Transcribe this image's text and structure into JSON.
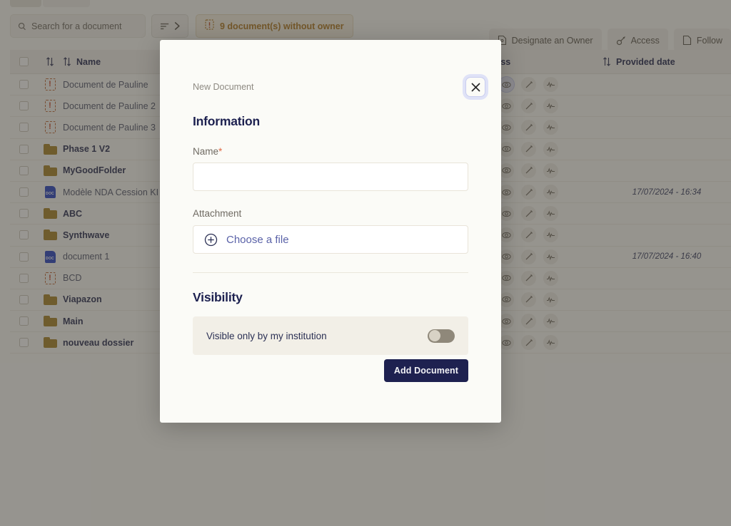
{
  "toolbar": {
    "search_placeholder": "Search for a document",
    "search_value": "",
    "search_icon": "search-icon",
    "filter_icon": "filter-lines-icon",
    "filter_chevron_icon": "chevron-right-icon",
    "warning_icon": "alert-document-icon",
    "warning_text": "9 document(s) without owner",
    "warning_color": "#b07a22",
    "actions": [
      {
        "label": "Designate an Owner",
        "icon": "document-user-icon"
      },
      {
        "label": "Access",
        "icon": "key-icon"
      },
      {
        "label": "Follow",
        "icon": "document-icon"
      }
    ]
  },
  "table": {
    "sort_icon": "sort-updown-icon",
    "headers": {
      "name": "Name",
      "access": "ly Access",
      "provided_date": "Provided date"
    },
    "rows": [
      {
        "icon": "alert-icon",
        "name": "Document de Pauline",
        "bold": false,
        "date": "",
        "highlight_eye": true
      },
      {
        "icon": "alert-icon",
        "name": "Document de Pauline 2",
        "bold": false,
        "date": "",
        "highlight_eye": false
      },
      {
        "icon": "alert-icon",
        "name": "Document de Pauline 3",
        "bold": false,
        "date": "",
        "highlight_eye": false
      },
      {
        "icon": "folder-icon",
        "name": "Phase 1 V2",
        "bold": true,
        "date": "",
        "highlight_eye": false
      },
      {
        "icon": "folder-icon",
        "name": "MyGoodFolder",
        "bold": true,
        "date": "",
        "highlight_eye": false
      },
      {
        "icon": "doc-icon",
        "name": "Modèle NDA Cession KI",
        "bold": false,
        "date": "17/07/2024 - 16:34",
        "highlight_eye": false
      },
      {
        "icon": "folder-icon",
        "name": "ABC",
        "bold": true,
        "date": "",
        "highlight_eye": false
      },
      {
        "icon": "folder-icon",
        "name": "Synthwave",
        "bold": true,
        "date": "",
        "highlight_eye": false
      },
      {
        "icon": "doc-icon",
        "name": "document 1",
        "bold": false,
        "date": "17/07/2024 - 16:40",
        "highlight_eye": false
      },
      {
        "icon": "alert-icon",
        "name": "BCD",
        "bold": false,
        "date": "",
        "highlight_eye": false
      },
      {
        "icon": "folder-icon",
        "name": "Viapazon",
        "bold": true,
        "date": "",
        "highlight_eye": false
      },
      {
        "icon": "folder-icon",
        "name": "Main",
        "bold": true,
        "date": "",
        "highlight_eye": false
      },
      {
        "icon": "folder-icon",
        "name": "nouveau dossier",
        "bold": true,
        "date": "",
        "highlight_eye": false
      }
    ],
    "row_action_icons": [
      "save-document-icon",
      "eye-icon",
      "pencil-icon",
      "activity-icon"
    ],
    "doc_icon_label": "DOC"
  },
  "modal": {
    "eyebrow": "New Document",
    "close_icon": "close-icon",
    "information_title": "Information",
    "name_label": "Name",
    "name_required_mark": "*",
    "name_value": "",
    "attachment_label": "Attachment",
    "choose_file_label": "Choose a file",
    "choose_file_icon": "plus-circle-icon",
    "visibility_title": "Visibility",
    "visibility_toggle_label": "Visible only by my institution",
    "visibility_toggle_state": "off",
    "submit_label": "Add Document",
    "submit_color": "#1e2150"
  }
}
